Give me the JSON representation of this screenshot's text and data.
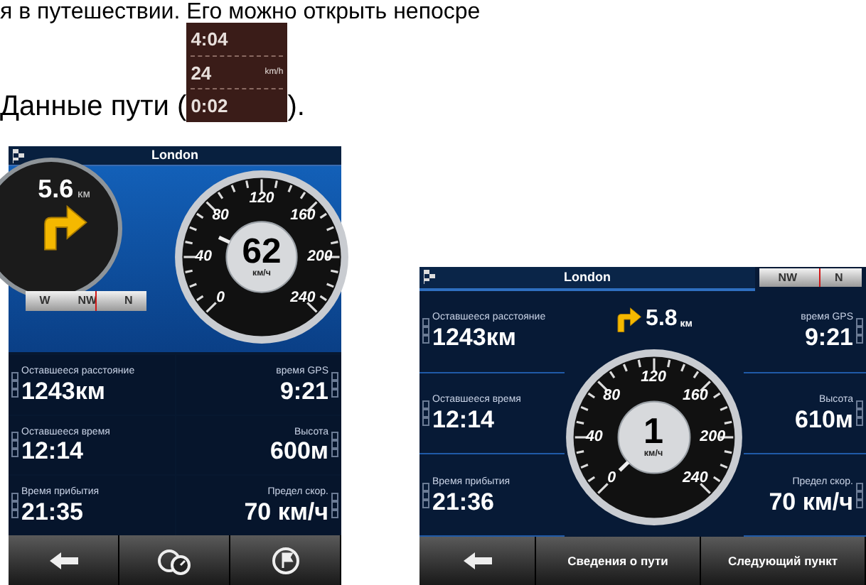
{
  "body_text": {
    "line_1": "я в путешествии. Его можно открыть непосре",
    "line_2_before": "Данные пути (",
    "line_2_after": ")."
  },
  "inline_icon": {
    "rows": [
      {
        "value": "4:04"
      },
      {
        "value": "24",
        "unit": "km/h"
      },
      {
        "value": "0:02"
      }
    ]
  },
  "screens": [
    {
      "kind": "portrait",
      "title": "London",
      "turn": {
        "distance": "5.6",
        "unit": "КМ"
      },
      "speedometer": {
        "speed": "62",
        "unit": "км/ч",
        "scale": [
          "0",
          "40",
          "80",
          "120",
          "160",
          "200",
          "240"
        ]
      },
      "compass": [
        "W",
        "NW",
        "N"
      ],
      "fields": [
        {
          "label": "Оставшееся расстояние",
          "value": "1243км"
        },
        {
          "label": "время GPS",
          "value": "9:21"
        },
        {
          "label": "Оставшееся время",
          "value": "12:14"
        },
        {
          "label": "Высота",
          "value": "600м"
        },
        {
          "label": "Время прибытия",
          "value": "21:35"
        },
        {
          "label": "Предел скор.",
          "value": "70 км/ч"
        }
      ],
      "buttons": [
        {
          "kind": "back"
        },
        {
          "kind": "gauges"
        },
        {
          "kind": "flag"
        }
      ]
    },
    {
      "kind": "landscape",
      "title": "London",
      "turn": {
        "distance": "5.8",
        "unit": "км"
      },
      "speedometer": {
        "speed": "1",
        "unit": "км/ч",
        "scale": [
          "0",
          "40",
          "80",
          "120",
          "160",
          "200",
          "240"
        ]
      },
      "compass": [
        "NW",
        "N"
      ],
      "fields": [
        {
          "label": "Оставшееся расстояние",
          "value": "1243км"
        },
        {
          "label": "время GPS",
          "value": "9:21"
        },
        {
          "label": "Оставшееся время",
          "value": "12:14"
        },
        {
          "label": "Высота",
          "value": "610м"
        },
        {
          "label": "Время прибытия",
          "value": "21:36"
        },
        {
          "label": "Предел скор.",
          "value": "70 км/ч"
        }
      ],
      "buttons": [
        {
          "kind": "back"
        },
        {
          "kind": "text",
          "label": "Сведения о пути"
        },
        {
          "kind": "text",
          "label": "Следующий пункт"
        }
      ]
    }
  ]
}
